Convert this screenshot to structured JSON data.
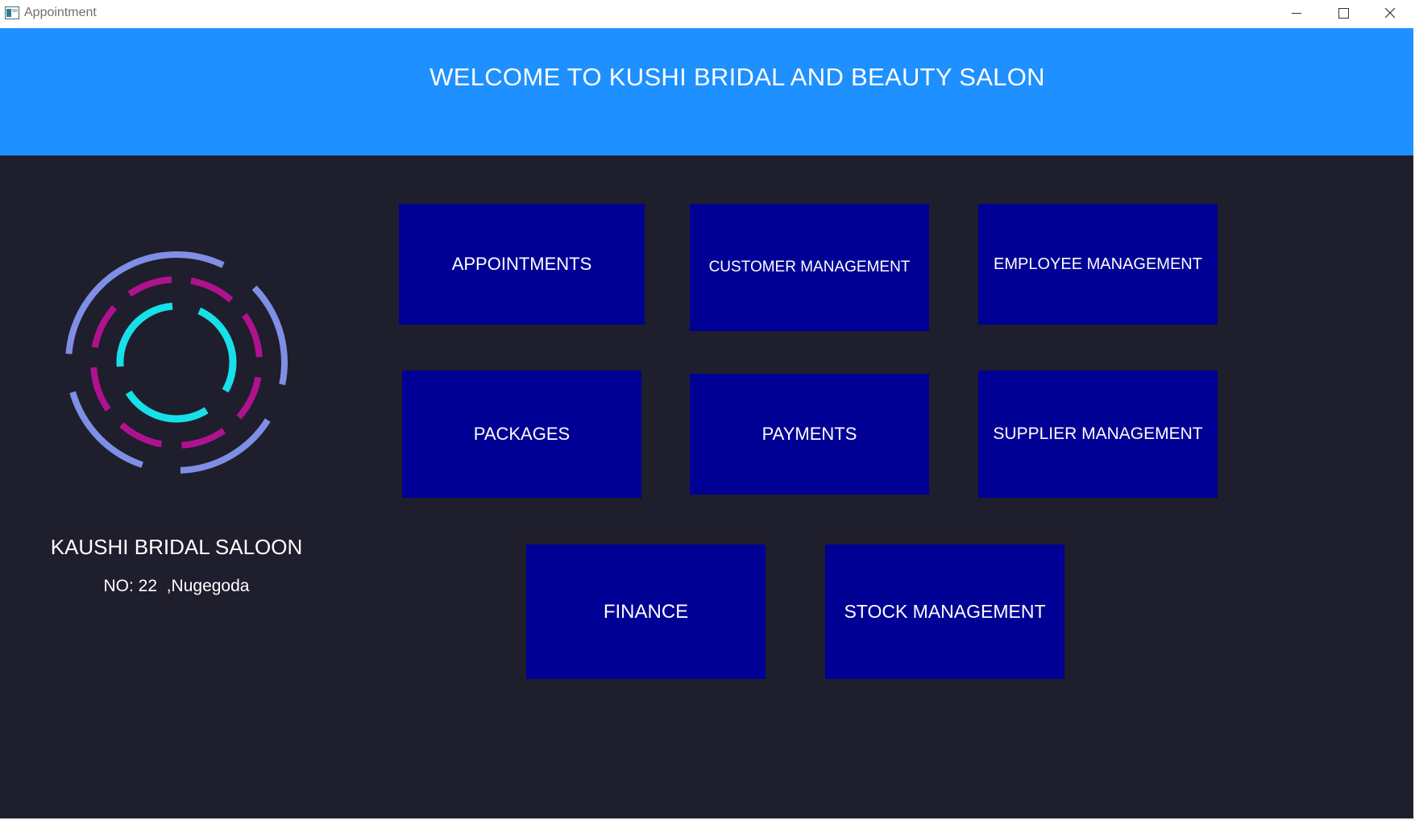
{
  "window": {
    "title": "Appointment",
    "controls": {
      "minimize_icon": "minimize-icon",
      "maximize_icon": "maximize-icon",
      "close_icon": "close-icon"
    }
  },
  "header": {
    "title": "WELCOME TO KUSHI BRIDAL AND BEAUTY SALON"
  },
  "sidebar": {
    "logo_icon": "dashed-circles-logo",
    "salon_name": "KAUSHI BRIDAL SALOON",
    "address": "NO: 22  ,Nugegoda"
  },
  "menu": {
    "appointments": "APPOINTMENTS",
    "customer_management": "CUSTOMER MANAGEMENT",
    "employee_management": "EMPLOYEE MANAGEMENT",
    "packages": "PACKAGES",
    "payments": "PAYMENTS",
    "supplier_management": "SUPPLIER MANAGEMENT",
    "finance": "FINANCE",
    "stock_management": "STOCK MANAGEMENT"
  },
  "colors": {
    "header_bg": "#1e90ff",
    "body_bg": "#1f1e2c",
    "button_bg": "#000094",
    "text": "#ffffff",
    "logo_outer": "#7f8fe6",
    "logo_middle": "#b0128f",
    "logo_inner": "#17e0e8"
  }
}
